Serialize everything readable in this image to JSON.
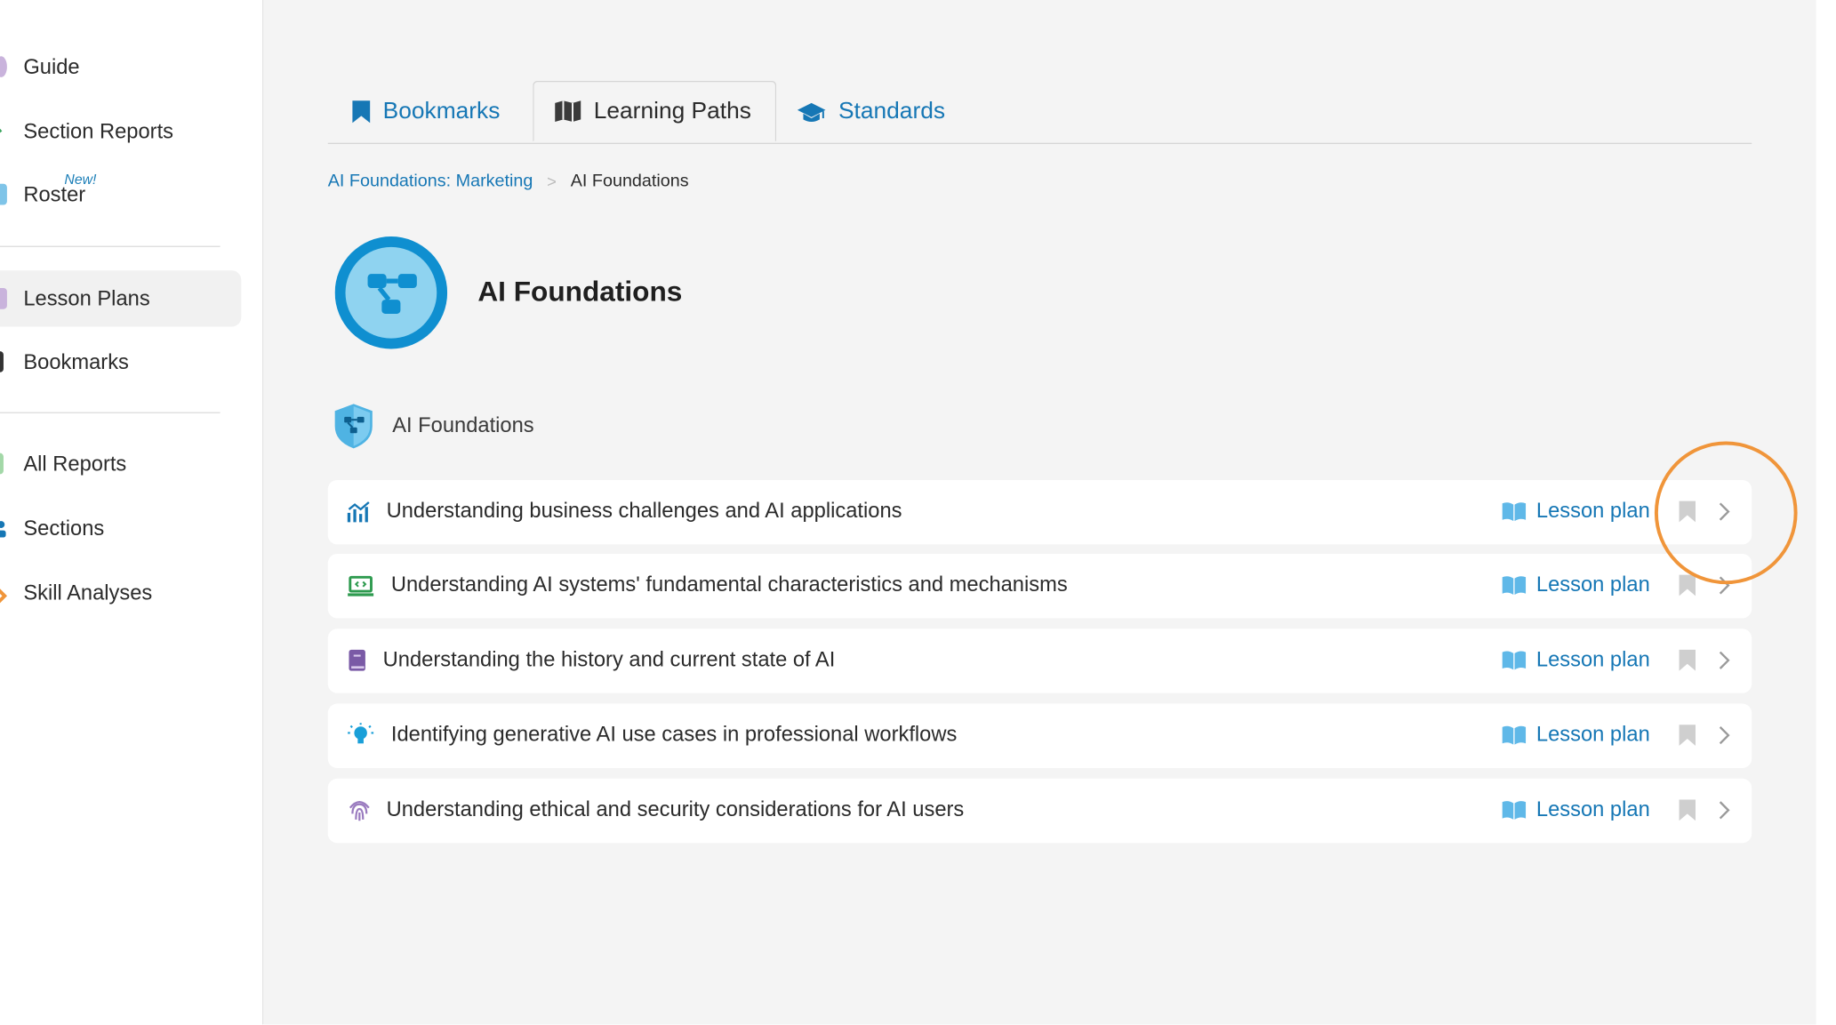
{
  "sidebar": {
    "items": [
      {
        "label": "Guide",
        "mark_color": "#c9b3dc"
      },
      {
        "label": "Section Reports",
        "mark_color": "#3aa55d"
      },
      {
        "label": "Roster",
        "mark_color": "#7fc4e8",
        "badge": "New!"
      },
      {
        "label": "Lesson Plans",
        "mark_color": "#c9b3dc",
        "active": true
      },
      {
        "label": "Bookmarks",
        "mark_color": "#333333"
      },
      {
        "label": "All Reports",
        "mark_color": "#a3d8a8"
      },
      {
        "label": "Sections",
        "mark_color": "#1677b5"
      },
      {
        "label": "Skill Analyses",
        "mark_color": "#f0953a"
      }
    ]
  },
  "tabs": [
    {
      "label": "Bookmarks",
      "icon": "bookmark-icon",
      "active": false
    },
    {
      "label": "Learning Paths",
      "icon": "map-icon",
      "active": true
    },
    {
      "label": "Standards",
      "icon": "graduation-cap-icon",
      "active": false
    }
  ],
  "breadcrumb": {
    "parent": "AI Foundations: Marketing",
    "separator": ">",
    "current": "AI Foundations"
  },
  "hero": {
    "title": "AI Foundations",
    "icon": "network-icon"
  },
  "group": {
    "title": "AI Foundations",
    "icon": "shield-network-icon"
  },
  "lessons": [
    {
      "title": "Understanding business challenges and AI applications",
      "icon": "chart-icon",
      "icon_color": "#1677b5",
      "action": "Lesson plan"
    },
    {
      "title": "Understanding AI systems' fundamental characteristics and mechanisms",
      "icon": "code-screen-icon",
      "icon_color": "#2e9b4f",
      "action": "Lesson plan"
    },
    {
      "title": "Understanding the history and current state of AI",
      "icon": "book-icon",
      "icon_color": "#7a5aa6",
      "action": "Lesson plan"
    },
    {
      "title": "Identifying generative AI use cases in professional workflows",
      "icon": "lightbulb-icon",
      "icon_color": "#1a9fd8",
      "action": "Lesson plan"
    },
    {
      "title": "Understanding ethical and security considerations for AI users",
      "icon": "fingerprint-icon",
      "icon_color": "#9a7bbf",
      "action": "Lesson plan"
    }
  ],
  "colors": {
    "accent": "#1677b5",
    "highlight": "#f0953a",
    "hero_ring": "#0f8fd0",
    "hero_fill": "#8fd3f0"
  }
}
